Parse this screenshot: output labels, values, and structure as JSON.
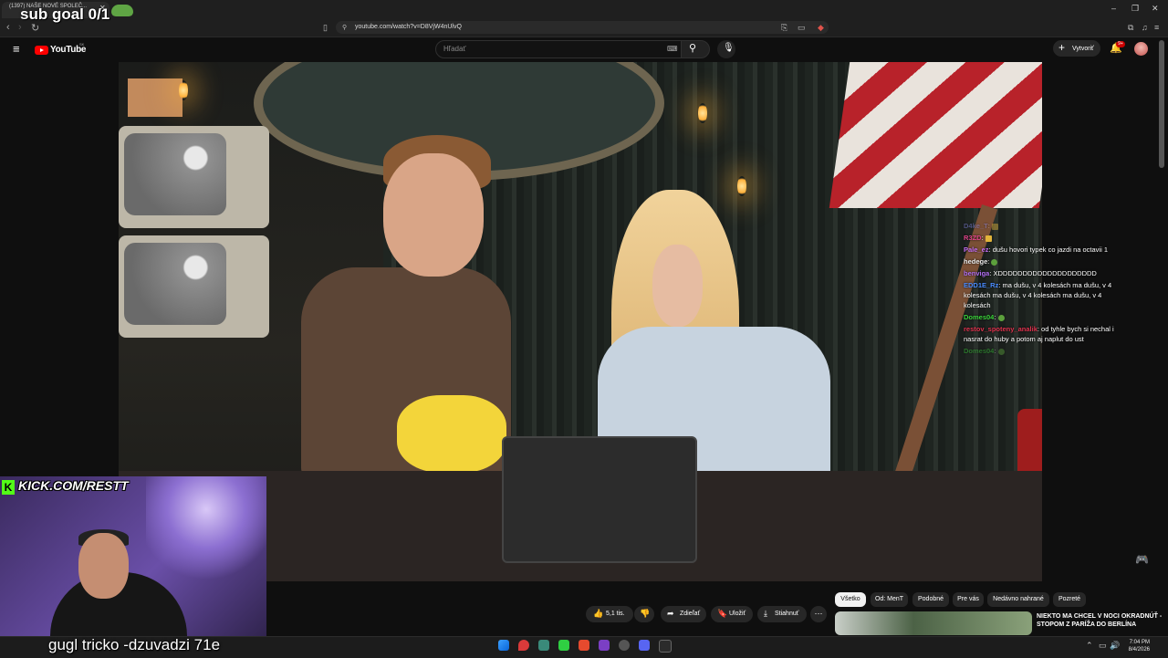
{
  "browser": {
    "tab_title": "(1397) NAŠE NOVÉ SPOLEČ...",
    "url": "youtube.com/watch?v=D8VjW4nUlvQ",
    "window_controls": [
      "–",
      "❐",
      "✕"
    ]
  },
  "overlay": {
    "sub_goal": "sub goal 0/1",
    "kick": "KICK.COM/RESTT",
    "caption": "gugl tricko -dzuvadzi 71e"
  },
  "youtube": {
    "logo_text": "YouTube",
    "region": "SK",
    "search_placeholder": "Hľadať",
    "create_label": "Vytvoriť",
    "notification_count": "9+"
  },
  "chat": [
    {
      "user": "D4ke_T",
      "user_color": "#8a8af0",
      "text": "",
      "emote": "yellow",
      "faded": true
    },
    {
      "user": "R3ZD",
      "user_color": "#e0458a",
      "text": "",
      "emote": "yellow",
      "faded": false
    },
    {
      "user": "Pale_ez",
      "user_color": "#c56ff3",
      "text": "dušu hovori typek co jazdi na octavii 1",
      "emote": "",
      "faded": false
    },
    {
      "user": "hedege",
      "user_color": "#e9e9e9",
      "text": "",
      "emote": "green",
      "faded": false
    },
    {
      "user": "benviga",
      "user_color": "#b06ef0",
      "text": "XDDDDDDDDDDDDDDDDDDDD",
      "emote": "",
      "faded": false
    },
    {
      "user": "EDD1E_Rz",
      "user_color": "#4a8cff",
      "text": "ma dušu, v 4 kolesách ma dušu, v 4 kolesách ma dušu, v 4 kolesách ma dušu, v 4 kolesách",
      "emote": "",
      "faded": false
    },
    {
      "user": "Domes04",
      "user_color": "#3ad23a",
      "text": "",
      "emote": "green",
      "faded": false
    },
    {
      "user": "restov_spoteny_analik",
      "user_color": "#e0334f",
      "text": "od tyhle bych si nechal i nasrat do huby a potom aj naplut do ust",
      "emote": "",
      "faded": false
    },
    {
      "user": "Domes04",
      "user_color": "#3ad23a",
      "text": "",
      "emote": "green",
      "faded": true
    }
  ],
  "actions": {
    "likes": "5,1 tis.",
    "share": "Zdieľať",
    "save": "Uložiť",
    "download": "Stiahnuť",
    "more": "⋯"
  },
  "chips": [
    "Všetko",
    "Od: MenT",
    "Podobné",
    "Pre vás",
    "Nedávno nahrané",
    "Pozreté"
  ],
  "recommendation": {
    "title": "NIEKTO MA CHCEL V NOCI OKRADNÚŤ - STOPOM Z PARÍŽA DO BERLÍNA"
  },
  "taskbar": {
    "time": "7:04 PM",
    "date": "8/4/2026"
  },
  "colors": {
    "youtube_red": "#ff0000",
    "kick_green": "#53fc18",
    "chip_selected_bg": "#f1f1f1"
  }
}
